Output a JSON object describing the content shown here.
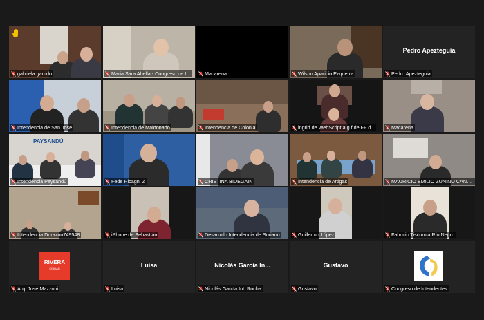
{
  "tiles": [
    {
      "name": "gabriela.garrido",
      "bg": "#5b3b2c"
    },
    {
      "name": "Maria Sara Abella - Congreso de I...",
      "bg": "#bdb5a8"
    },
    {
      "name": "Macarena",
      "bg": "#000000",
      "active": true
    },
    {
      "name": "Wilson Aparicio Ezquerra",
      "bg": "#7a6a5a"
    },
    {
      "name": "Pedro Apezteguia",
      "bg": "#232323",
      "center_name": "Pedro Apezteguia"
    },
    {
      "name": "Intendencia  de San José",
      "bg": "#c7cfd9"
    },
    {
      "name": "Intendencia de Maldonado",
      "bg": "#b7b0a3"
    },
    {
      "name": "Intendencia de Colonia",
      "bg": "#8a6f5a"
    },
    {
      "name": "ingrid de WebScript  a g f de FF  d...",
      "bg": "#151515"
    },
    {
      "name": "Macarena",
      "bg": "#9a8f86"
    },
    {
      "name": "Intendencia Paysandú",
      "bg": "#d8d4cf",
      "banner": "PAYSANDÚ"
    },
    {
      "name": "Fede Ricagni Z",
      "bg": "#2f5fa3"
    },
    {
      "name": "CRISTINA BIDEGAIN",
      "bg": "#8a8c95"
    },
    {
      "name": "Intendencia de Artigas",
      "bg": "#7b5a3f"
    },
    {
      "name": "MAURICIO EMILIO ZUNINO CANEPA",
      "bg": "#8f8a86"
    },
    {
      "name": "Intendencia Durazno749548",
      "bg": "#b2a48f"
    },
    {
      "name": "iPhone de Sebastián",
      "bg": "#171717"
    },
    {
      "name": "Desarrollo Intendencia de Soriano",
      "bg": "#5d6a7a"
    },
    {
      "name": "Guillermo López",
      "bg": "#171717"
    },
    {
      "name": "Fabricio Tiscornia Río Negro",
      "bg": "#171717"
    },
    {
      "name": "Arq. José Mazzoni",
      "bg": "#232323",
      "logo_text": "RIVERA",
      "logo_sub": "CIUDAD"
    },
    {
      "name": "Luisa",
      "bg": "#232323",
      "center_name": "Luisa"
    },
    {
      "name": "Nicolás García Int. Rocha",
      "bg": "#232323",
      "center_name": "Nicolás García In..."
    },
    {
      "name": "Gustavo",
      "bg": "#232323",
      "center_name": "Gustavo"
    },
    {
      "name": "Congreso de Intendentes",
      "bg": "#232323",
      "congreso_logo": true
    }
  ],
  "colors": {
    "active_border": "#c9b84a",
    "mic_muted": "#e23b2e",
    "rivera_red": "#e63b2a"
  },
  "icons": {
    "muted": "mic-muted-icon",
    "hand": "raised-hand-icon"
  }
}
